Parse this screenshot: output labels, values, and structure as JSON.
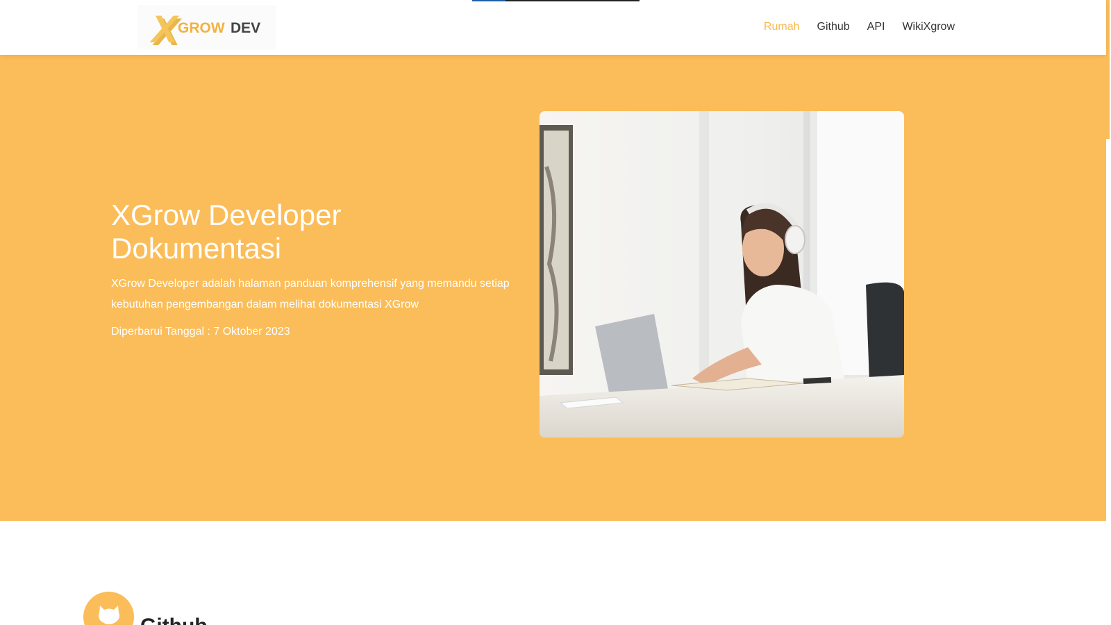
{
  "header": {
    "logo": {
      "text_x": "X",
      "text_grow": "GROW",
      "text_dev": "DEV"
    },
    "scroll_progress": 0.2,
    "nav": [
      {
        "label": "Rumah",
        "active": true
      },
      {
        "label": "Github",
        "active": false
      },
      {
        "label": "API",
        "active": false
      },
      {
        "label": "WikiXgrow",
        "active": false
      }
    ]
  },
  "hero": {
    "title": "XGrow Developer Dokumentasi",
    "description": "XGrow Developer adalah halaman panduan komprehensif yang memandu setiap kebutuhan pengembangan dalam melihat dokumentasi XGrow",
    "updated": "Diperbarui Tanggal : 7 Oktober 2023",
    "image_icon": "woman-laptop-headphones-photo"
  },
  "section": {
    "title": "Github",
    "icon": "github-icon"
  },
  "colors": {
    "accent": "#fbbd59",
    "nav_active": "#f9b94e",
    "text_dark": "#333333"
  }
}
